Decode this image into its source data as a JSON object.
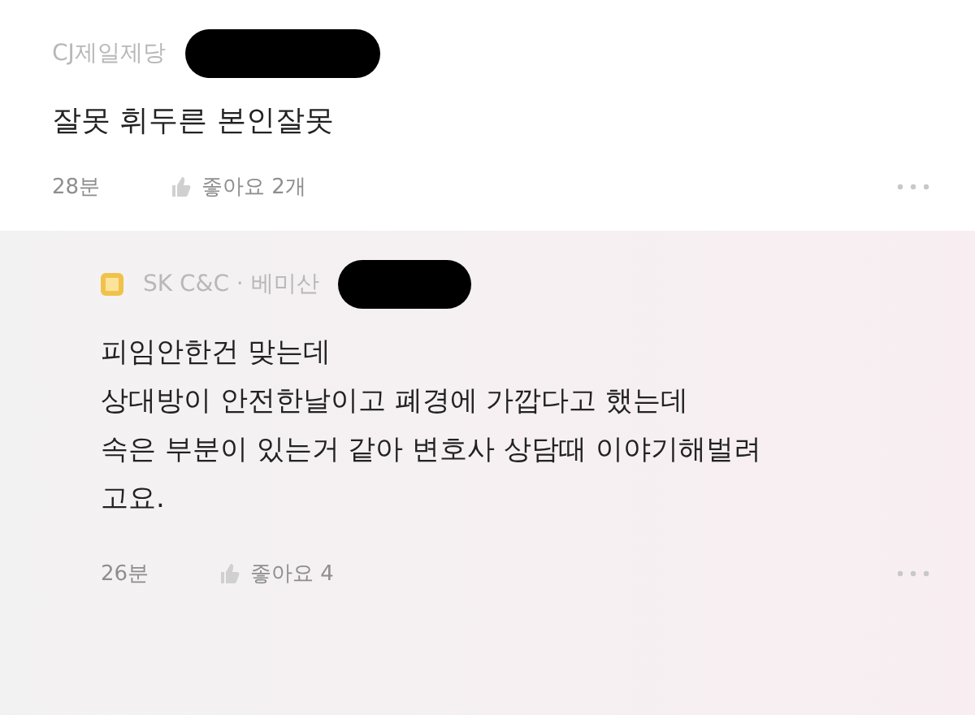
{
  "comment": {
    "author": "CJ제일제당",
    "body": "잘못 휘두른 본인잘못",
    "time": "28분",
    "likes": "좋아요 2개"
  },
  "reply": {
    "author": "SK C&C · 베미산",
    "lines": [
      "피임안한건 맞는데",
      "상대방이 안전한날이고 폐경에 가깝다고 했는데",
      "속은 부분이 있는거 같아 변호사 상담때 이야기해벌려",
      "고요."
    ],
    "time": "26분",
    "likes": "좋아요 4"
  }
}
